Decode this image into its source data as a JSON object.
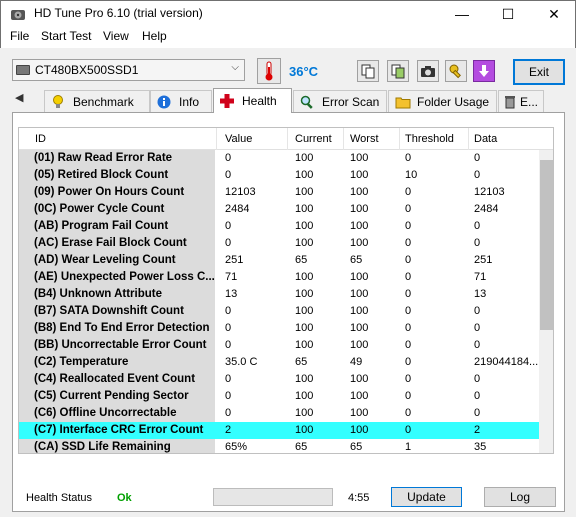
{
  "window": {
    "title": "HD Tune Pro 6.10 (trial version)",
    "minimize_glyph": "—",
    "maximize_glyph": "☐",
    "close_glyph": "✕"
  },
  "menu": [
    "File",
    "Start Test",
    "View",
    "Help"
  ],
  "toolbar": {
    "drive": "CT480BX500SSD1",
    "drive_arrow": "⌵",
    "temperature": "36°C",
    "exit_label": "Exit"
  },
  "tabs": {
    "scroll_left": "◀",
    "items": [
      "Benchmark",
      "Info",
      "Health",
      "Error Scan",
      "Folder Usage",
      "E..."
    ],
    "active": "Health"
  },
  "table": {
    "columns": [
      "ID",
      "Value",
      "Current",
      "Worst",
      "Threshold",
      "Data"
    ],
    "rows": [
      [
        "(01) Raw Read Error Rate",
        "0",
        "100",
        "100",
        "0",
        "0"
      ],
      [
        "(05) Retired Block Count",
        "0",
        "100",
        "100",
        "10",
        "0"
      ],
      [
        "(09) Power On Hours Count",
        "12103",
        "100",
        "100",
        "0",
        "12103"
      ],
      [
        "(0C) Power Cycle Count",
        "2484",
        "100",
        "100",
        "0",
        "2484"
      ],
      [
        "(AB) Program Fail Count",
        "0",
        "100",
        "100",
        "0",
        "0"
      ],
      [
        "(AC) Erase Fail Block Count",
        "0",
        "100",
        "100",
        "0",
        "0"
      ],
      [
        "(AD) Wear Leveling Count",
        "251",
        "65",
        "65",
        "0",
        "251"
      ],
      [
        "(AE) Unexpected Power Loss C...",
        "71",
        "100",
        "100",
        "0",
        "71"
      ],
      [
        "(B4) Unknown Attribute",
        "13",
        "100",
        "100",
        "0",
        "13"
      ],
      [
        "(B7) SATA Downshift Count",
        "0",
        "100",
        "100",
        "0",
        "0"
      ],
      [
        "(B8) End To End Error Detection",
        "0",
        "100",
        "100",
        "0",
        "0"
      ],
      [
        "(BB) Uncorrectable Error Count",
        "0",
        "100",
        "100",
        "0",
        "0"
      ],
      [
        "(C2) Temperature",
        "35.0 C",
        "65",
        "49",
        "0",
        "219044184..."
      ],
      [
        "(C4) Reallocated Event Count",
        "0",
        "100",
        "100",
        "0",
        "0"
      ],
      [
        "(C5) Current Pending Sector",
        "0",
        "100",
        "100",
        "0",
        "0"
      ],
      [
        "(C6) Offline Uncorrectable",
        "0",
        "100",
        "100",
        "0",
        "0"
      ],
      [
        "(C7) Interface CRC Error Count",
        "2",
        "100",
        "100",
        "0",
        "2"
      ],
      [
        "(CA) SSD Life Remaining",
        "65%",
        "65",
        "65",
        "1",
        "35"
      ]
    ],
    "highlighted_row": 16,
    "highlight_color": "#33ffff"
  },
  "status": {
    "label": "Health Status",
    "value": "Ok",
    "value_color": "#00a000",
    "progress": 0,
    "time": "4:55",
    "update_label": "Update",
    "log_label": "Log"
  }
}
